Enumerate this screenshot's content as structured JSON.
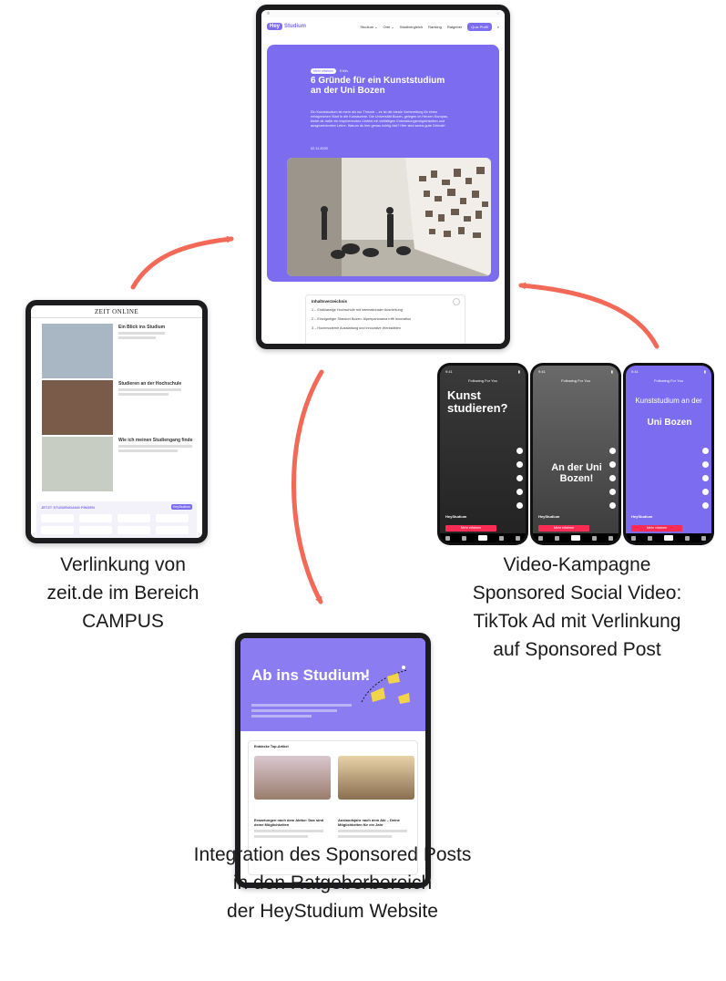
{
  "colors": {
    "brand": "#7b6cf0",
    "arrow": "#f26a57",
    "tiktok_red": "#fe2c55"
  },
  "main_tablet": {
    "nav": {
      "logo_hey": "Hey",
      "logo_rest": "Studium",
      "items": [
        "Studium ⌄",
        "Orte ⌄",
        "Stadtvergleich",
        "Ranking",
        "Ratgeber"
      ],
      "cta": "Quiz Profil"
    },
    "hero": {
      "badge": "Mehr erfahren",
      "read_time": "5 Min.",
      "title": "6 Gründe für ein Kunststudium an der Uni Bozen",
      "text": "Ein Kunststudium ist mehr als nur Theorie – es ist die ideale Vorbereitung für einen erfolgreichen Start in die Kunstszene. Die Universität Bozen, gelegen im Herzen Europas, bietet dir dafür ein inspirierendes Umfeld mit vielfältigen Entwicklungsmöglichkeiten und ausgezeichneter Lehre. Warum du hier genau richtig bist? Hier sind sechs gute Gründe!",
      "date": "02.11.2025",
      "image_icon": "gallery-photo-icon"
    },
    "toc": {
      "title": "Inhaltsverzeichnis",
      "items": [
        "1 – Erstklassige Hochschule mit internationaler Ausrichtung",
        "2 – Einzigartiger Standort Bozen: Alpenpanorama trifft Innovation",
        "3 – Hochmoderne Ausstattung und innovative Werkstätten"
      ]
    }
  },
  "zeit_tablet": {
    "header": "ZEIT ONLINE",
    "box_title": "JETZT STUDIENGANG FINDEN",
    "box_logo": "HeyStudium",
    "articles": [
      {
        "kicker": "",
        "headline": "Ein Blick ins Studium"
      },
      {
        "kicker": "",
        "headline": "Studieren an der Hochschule"
      },
      {
        "kicker": "",
        "headline": "Wie ich meinen Studiengang finde"
      }
    ]
  },
  "phones": [
    {
      "time": "9:41",
      "tabs": "Following   For You",
      "big_text": "Kunst studieren?",
      "handle": "HeyStudium",
      "cta": "Mehr erfahren"
    },
    {
      "time": "9:41",
      "tabs": "Following   For You",
      "big_text": "An der Uni Bozen!",
      "handle": "HeyStudium",
      "cta": "Mehr erfahren"
    },
    {
      "time": "9:41",
      "tabs": "Following   For You",
      "big_text_top": "Kunststudium an der",
      "big_text_bottom": "Uni Bozen",
      "handle": "HeyStudium",
      "cta": "Mehr erfahren"
    }
  ],
  "bottom_tablet": {
    "title": "Ab ins Studium!",
    "section_head": "Entdecke Top-Artikel",
    "cards": [
      {
        "headline": "Erwartungen nach dem Abitur: Das sind deine Möglichkeiten"
      },
      {
        "headline": "Auslandsjahr nach dem Abi – Deine Möglichkeiten für ein Jahr"
      }
    ]
  },
  "captions": {
    "zeit": [
      "Verlinkung von",
      "zeit.de im Bereich",
      "CAMPUS"
    ],
    "video": [
      "Video-Kampagne",
      "Sponsored Social Video:",
      "TikTok Ad mit Verlinkung",
      "auf Sponsored Post"
    ],
    "integration": [
      "Integration des Sponsored Posts",
      "in den Ratgeberbereich",
      "der HeyStudium Website"
    ]
  }
}
